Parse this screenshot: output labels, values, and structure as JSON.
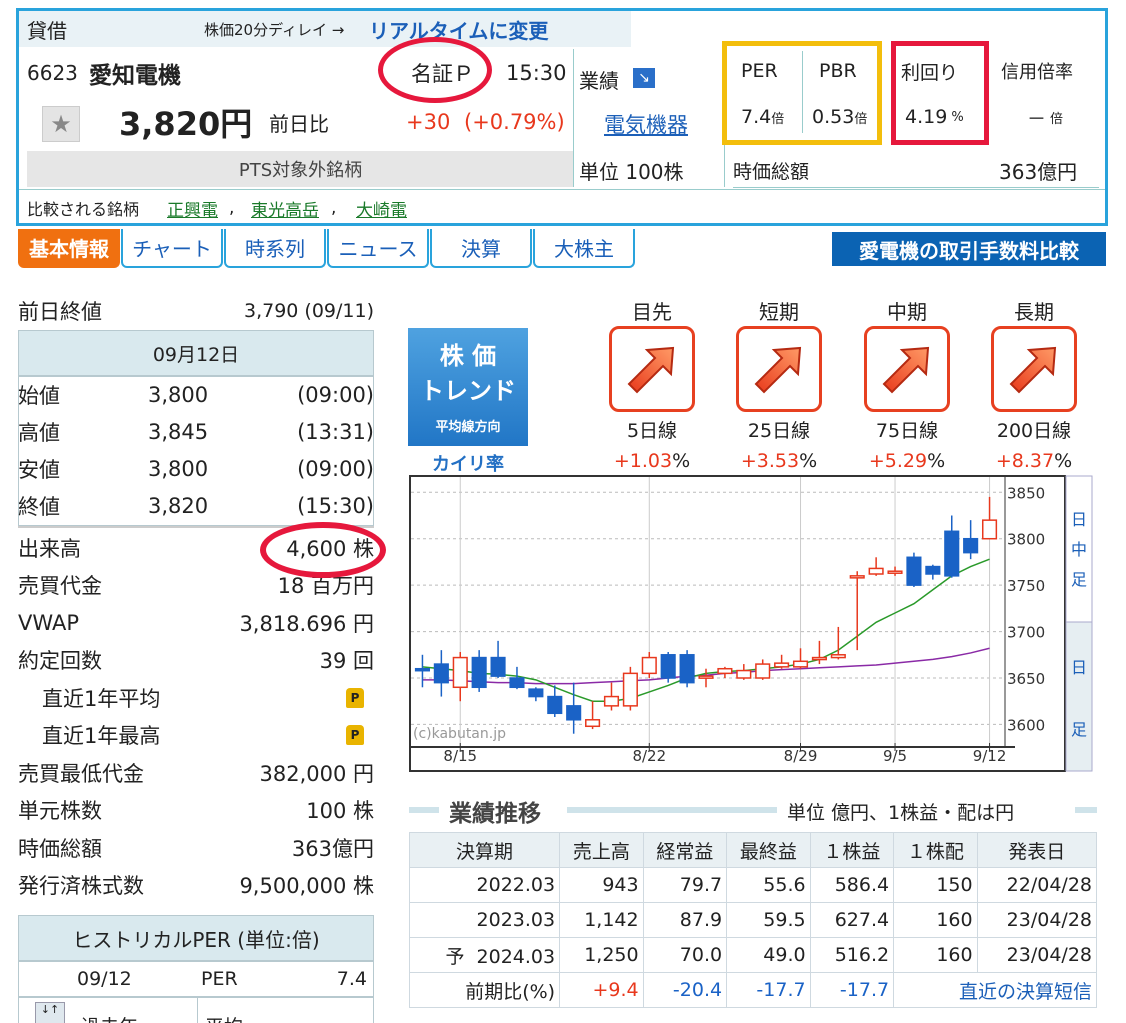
{
  "header": {
    "margin_label": "貸借",
    "delay_text": "株価20分ディレイ →",
    "realtime_link": "リアルタイムに変更",
    "code": "6623",
    "name": "愛知電機",
    "market": "名証Ｐ",
    "time": "15:30",
    "earnings_label": "業績",
    "sector": "電気機器",
    "price": "3,820円",
    "change_label": "前日比",
    "change": "+30",
    "change_pct": "(+0.79%)",
    "pts": "PTS対象外銘柄",
    "unit": "単位 100株",
    "per_label": "PER",
    "per_value": "7.4",
    "per_unit": "倍",
    "pbr_label": "PBR",
    "pbr_value": "0.53",
    "pbr_unit": "倍",
    "yield_label": "利回り",
    "yield_value": "4.19",
    "yield_unit": "%",
    "margin_ratio_label": "信用倍率",
    "margin_ratio_value": "－",
    "margin_ratio_unit": "倍",
    "market_cap_label": "時価総額",
    "market_cap_value": "363億円",
    "compare_label": "比較される銘柄",
    "compare": [
      "正興電",
      "東光高岳",
      "大崎電"
    ]
  },
  "tabs": [
    "基本情報",
    "チャート",
    "時系列",
    "ニュース",
    "決算",
    "大株主"
  ],
  "ad": "愛電機の取引手数料比較",
  "left": {
    "prev_close_label": "前日終値",
    "prev_close_value": "3,790 (09/11)",
    "date": "09月12日",
    "ohlc": [
      {
        "label": "始値",
        "value": "3,800",
        "time": "(09:00)"
      },
      {
        "label": "高値",
        "value": "3,845",
        "time": "(13:31)"
      },
      {
        "label": "安値",
        "value": "3,800",
        "time": "(09:00)"
      },
      {
        "label": "終値",
        "value": "3,820",
        "time": "(15:30)"
      }
    ],
    "stats": [
      {
        "label": "出来高",
        "value": "4,600 株"
      },
      {
        "label": "売買代金",
        "value": "18 百万円"
      },
      {
        "label": "VWAP",
        "value": "3,818.696 円"
      },
      {
        "label": "約定回数",
        "value": "39 回"
      },
      {
        "label": "直近1年平均",
        "value": ""
      },
      {
        "label": "直近1年最高",
        "value": ""
      },
      {
        "label": "売買最低代金",
        "value": "382,000 円"
      },
      {
        "label": "単元株数",
        "value": "100 株"
      },
      {
        "label": "時価総額",
        "value": "363億円"
      },
      {
        "label": "発行済株式数",
        "value": "9,500,000 株"
      }
    ],
    "hist_title": "ヒストリカルPER (単位:倍)",
    "hist_date": "09/12",
    "hist_label": "PER",
    "hist_value": "7.4",
    "premium_icon": "P"
  },
  "trend": {
    "logo_line1": "株 価",
    "logo_line2": "トレンド",
    "logo_line3": "平均線方向",
    "kairi_label": "カイリ率",
    "items": [
      {
        "period": "目先",
        "line": "5日線",
        "kairi": "+1.03",
        "icon": "up-right-arrow-icon"
      },
      {
        "period": "短期",
        "line": "25日線",
        "kairi": "+3.53",
        "icon": "up-right-arrow-icon"
      },
      {
        "period": "中期",
        "line": "75日線",
        "kairi": "+5.29",
        "icon": "up-right-arrow-icon"
      },
      {
        "period": "長期",
        "line": "200日線",
        "kairi": "+8.37",
        "icon": "up-right-arrow-icon"
      }
    ],
    "pct": "%"
  },
  "chart_data": {
    "type": "candlestick",
    "credit": "(c)kabutan.jp",
    "ylim": [
      3580,
      3860
    ],
    "yticks": [
      3600,
      3650,
      3700,
      3750,
      3800,
      3850
    ],
    "xticks": [
      "8/15",
      "8/22",
      "8/29",
      "9/5",
      "9/12"
    ],
    "side_tabs": [
      "日中足",
      "日足"
    ],
    "candles": [
      {
        "o": 3660,
        "c": 3658,
        "h": 3675,
        "l": 3640
      },
      {
        "o": 3665,
        "c": 3645,
        "h": 3680,
        "l": 3630
      },
      {
        "o": 3640,
        "c": 3672,
        "h": 3678,
        "l": 3625
      },
      {
        "o": 3672,
        "c": 3640,
        "h": 3680,
        "l": 3635
      },
      {
        "o": 3672,
        "c": 3652,
        "h": 3690,
        "l": 3650
      },
      {
        "o": 3650,
        "c": 3640,
        "h": 3662,
        "l": 3638
      },
      {
        "o": 3638,
        "c": 3630,
        "h": 3640,
        "l": 3625
      },
      {
        "o": 3630,
        "c": 3612,
        "h": 3642,
        "l": 3608
      },
      {
        "o": 3620,
        "c": 3605,
        "h": 3645,
        "l": 3590
      },
      {
        "o": 3598,
        "c": 3605,
        "h": 3625,
        "l": 3595
      },
      {
        "o": 3620,
        "c": 3630,
        "h": 3645,
        "l": 3615
      },
      {
        "o": 3620,
        "c": 3655,
        "h": 3662,
        "l": 3615
      },
      {
        "o": 3655,
        "c": 3672,
        "h": 3678,
        "l": 3650
      },
      {
        "o": 3675,
        "c": 3650,
        "h": 3678,
        "l": 3645
      },
      {
        "o": 3675,
        "c": 3645,
        "h": 3680,
        "l": 3640
      },
      {
        "o": 3650,
        "c": 3652,
        "h": 3660,
        "l": 3640
      },
      {
        "o": 3655,
        "c": 3660,
        "h": 3662,
        "l": 3650
      },
      {
        "o": 3650,
        "c": 3658,
        "h": 3665,
        "l": 3648
      },
      {
        "o": 3650,
        "c": 3665,
        "h": 3670,
        "l": 3648
      },
      {
        "o": 3662,
        "c": 3666,
        "h": 3675,
        "l": 3660
      },
      {
        "o": 3662,
        "c": 3668,
        "h": 3682,
        "l": 3660
      },
      {
        "o": 3670,
        "c": 3672,
        "h": 3690,
        "l": 3665
      },
      {
        "o": 3672,
        "c": 3675,
        "h": 3705,
        "l": 3670
      },
      {
        "o": 3760,
        "c": 3760,
        "h": 3765,
        "l": 3680
      },
      {
        "o": 3762,
        "c": 3768,
        "h": 3780,
        "l": 3760
      },
      {
        "o": 3765,
        "c": 3765,
        "h": 3770,
        "l": 3760
      },
      {
        "o": 3780,
        "c": 3750,
        "h": 3785,
        "l": 3748
      },
      {
        "o": 3770,
        "c": 3762,
        "h": 3772,
        "l": 3756
      },
      {
        "o": 3808,
        "c": 3760,
        "h": 3825,
        "l": 3758
      },
      {
        "o": 3800,
        "c": 3785,
        "h": 3820,
        "l": 3778
      },
      {
        "o": 3800,
        "c": 3820,
        "h": 3845,
        "l": 3800
      }
    ],
    "ma_short": [
      3662,
      3660,
      3658,
      3655,
      3654,
      3652,
      3648,
      3640,
      3632,
      3625,
      3625,
      3628,
      3635,
      3642,
      3650,
      3655,
      3657,
      3658,
      3660,
      3662,
      3665,
      3670,
      3680,
      3695,
      3710,
      3720,
      3730,
      3745,
      3760,
      3770,
      3778
    ],
    "ma_long": [
      3648,
      3648,
      3647,
      3646,
      3645,
      3645,
      3644,
      3644,
      3644,
      3645,
      3646,
      3647,
      3648,
      3650,
      3652,
      3653,
      3655,
      3656,
      3658,
      3659,
      3660,
      3661,
      3662,
      3663,
      3664,
      3666,
      3668,
      3670,
      3673,
      3677,
      3682
    ]
  },
  "perf": {
    "title": "業績推移",
    "unit": "単位 億円、1株益・配は円",
    "headers": [
      "決算期",
      "売上高",
      "経常益",
      "最終益",
      "１株益",
      "１株配",
      "発表日"
    ],
    "rows": [
      [
        "2022.03",
        "943",
        "79.7",
        "55.6",
        "586.4",
        "150",
        "22/04/28"
      ],
      [
        "2023.03",
        "1,142",
        "87.9",
        "59.5",
        "627.4",
        "160",
        "23/04/28"
      ],
      [
        "予  2024.03",
        "1,250",
        "70.0",
        "49.0",
        "516.2",
        "160",
        "23/04/28"
      ]
    ],
    "compare_label": "前期比(%)",
    "compare": [
      "+9.4",
      "-20.4",
      "-17.7",
      "-17.7"
    ],
    "tanshin_link": "直近の決算短信"
  },
  "bottom_partial": {
    "label1": "過去年",
    "label2": "平均"
  }
}
